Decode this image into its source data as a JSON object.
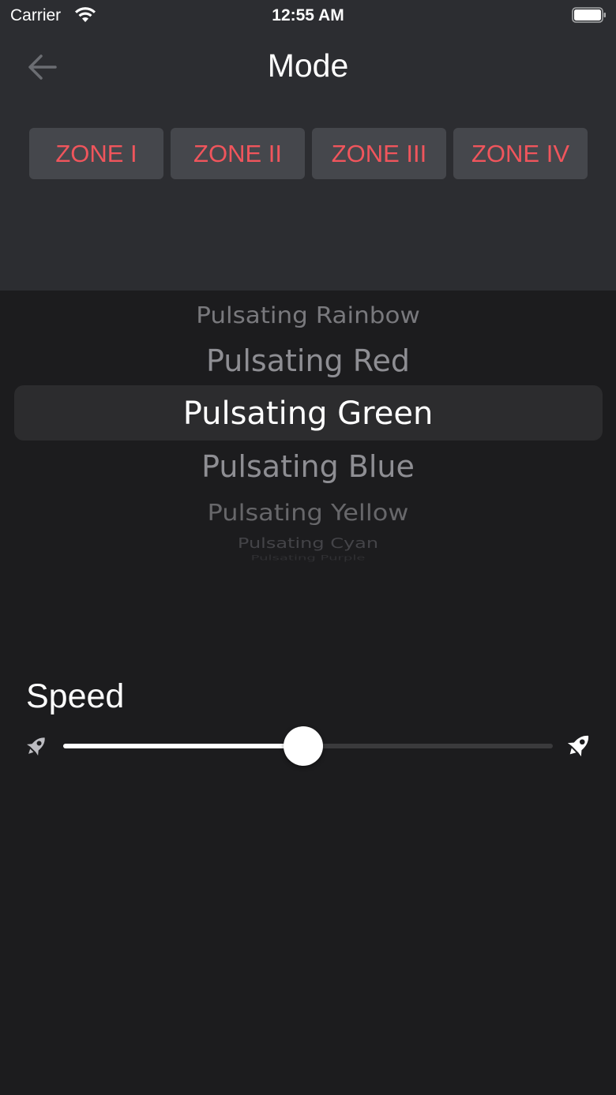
{
  "status_bar": {
    "carrier": "Carrier",
    "time": "12:55 AM"
  },
  "nav": {
    "title": "Mode",
    "back_icon": "arrow-left-icon"
  },
  "zones": [
    {
      "label": "ZONE I"
    },
    {
      "label": "ZONE II"
    },
    {
      "label": "ZONE III"
    },
    {
      "label": "ZONE IV"
    }
  ],
  "picker": {
    "items": [
      "Pulsating Rainbow",
      "Pulsating Red",
      "Pulsating Green",
      "Pulsating Blue",
      "Pulsating Yellow",
      "Pulsating Cyan",
      "Pulsating Purple"
    ],
    "selected": "Pulsating Green"
  },
  "speed": {
    "label": "Speed",
    "value_fraction": 0.49,
    "min_icon": "rocket-slow-icon",
    "max_icon": "rocket-fast-icon"
  },
  "colors": {
    "accent": "#f0555c",
    "header_bg": "#2c2d31",
    "body_bg": "#1c1c1e",
    "zone_button_bg": "#45474c"
  }
}
